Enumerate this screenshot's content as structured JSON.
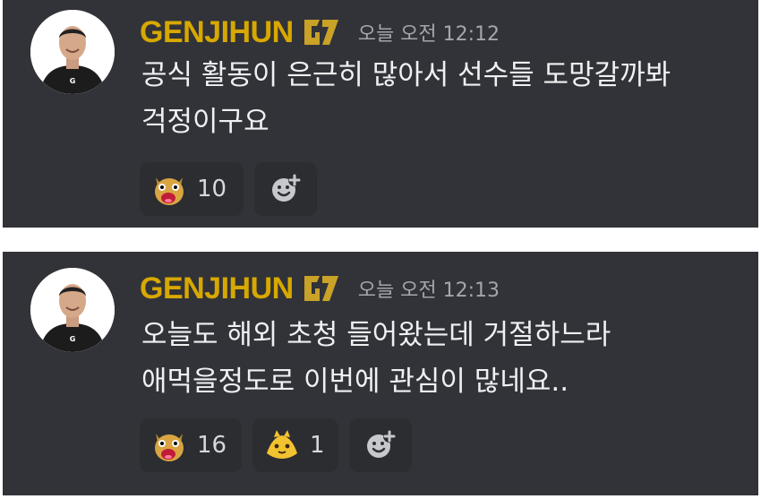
{
  "messages": [
    {
      "username": "GENJIHUN",
      "timestamp": "오늘 오전 12:12",
      "content": "공식 활동이 은근히 많아서 선수들 도망갈까봐\n걱정이구요",
      "reactions": [
        {
          "emoji": "cat-shouting-emoji",
          "count": "10"
        }
      ],
      "add_reaction_icon": "add-reaction-icon"
    },
    {
      "username": "GENJIHUN",
      "timestamp": "오늘 오전 12:13",
      "content": "오늘도 해외 초청 들어왔는데 거절하느라\n애먹을정도로 이번에 관심이 많네요..",
      "reactions": [
        {
          "emoji": "cat-shouting-emoji",
          "count": "16"
        },
        {
          "emoji": "yellow-creature-emoji",
          "count": "1"
        }
      ],
      "add_reaction_icon": "add-reaction-icon"
    }
  ],
  "colors": {
    "background": "#313338",
    "username": "#d8a800",
    "timestamp": "#a3a6ad",
    "text": "#eef0f2",
    "reaction_bg": "#2b2d31"
  }
}
